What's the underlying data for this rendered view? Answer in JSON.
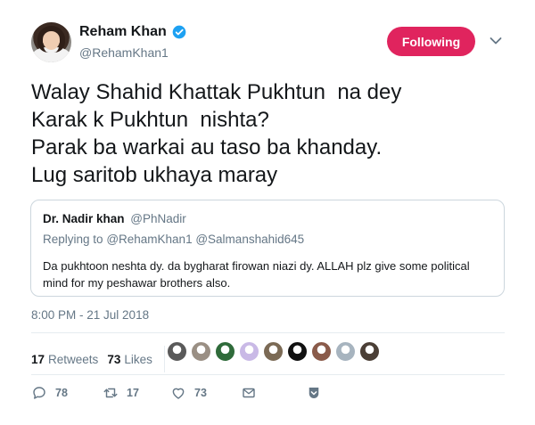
{
  "author": {
    "display_name": "Reham Khan",
    "handle": "@RehamKhan1",
    "verified": true
  },
  "follow_button": {
    "label": "Following",
    "color": "#e0245e"
  },
  "tweet": {
    "lines": [
      "Walay Shahid Khattak Pukhtun  na dey",
      "Karak k Pukhtun  nishta?",
      "Parak ba warkai au taso ba khanday.",
      "Lug saritob ukhaya maray"
    ],
    "timestamp": "8:00 PM - 21 Jul 2018"
  },
  "quoted_tweet": {
    "display_name": "Dr. Nadir khan",
    "handle": "@PhNadir",
    "replying_prefix": "Replying to",
    "replying_to": [
      "@RehamKhan1",
      "@Salmanshahid645"
    ],
    "text": "Da pukhtoon neshta dy. da bygharat firowan niazi dy. ALLAH plz give some political mind for my peshawar brothers also."
  },
  "stats": {
    "retweets_count": "17",
    "retweets_label": "Retweets",
    "likes_count": "73",
    "likes_label": "Likes"
  },
  "likers": [
    {
      "icon": "liker-avatar-1",
      "color": "#5a5a5a"
    },
    {
      "icon": "liker-avatar-2",
      "color": "#9a8f84"
    },
    {
      "icon": "liker-avatar-3",
      "color": "#2f6b3a"
    },
    {
      "icon": "liker-avatar-4",
      "color": "#c9b9e6"
    },
    {
      "icon": "liker-avatar-5",
      "color": "#7b6a55"
    },
    {
      "icon": "liker-avatar-6",
      "color": "#111111"
    },
    {
      "icon": "liker-avatar-7",
      "color": "#8a5b4a"
    },
    {
      "icon": "liker-avatar-8",
      "color": "#a7b4bf"
    },
    {
      "icon": "liker-avatar-9",
      "color": "#4b3f36"
    }
  ],
  "actions": {
    "reply_count": "78",
    "retweet_count": "17",
    "like_count": "73"
  },
  "colors": {
    "text": "#14171a",
    "secondary": "#657786",
    "border": "#ccd6dd",
    "verified": "#1da1f2"
  }
}
